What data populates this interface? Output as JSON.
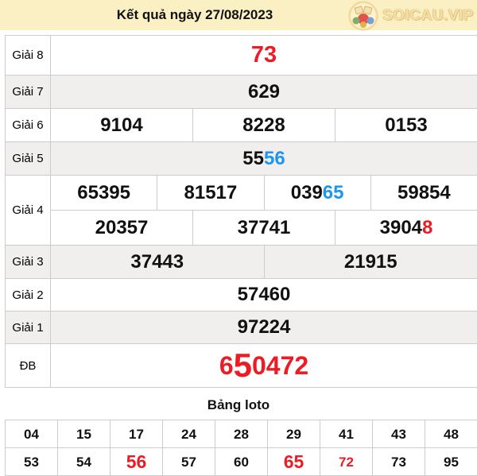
{
  "header": {
    "title": "Kết quả ngày 27/08/2023",
    "logo_text": "SOICAU.VIP"
  },
  "colors": {
    "accent_red": "#ed1c24",
    "accent_blue": "#1d96f0",
    "header_bg": "#fbf0c3",
    "row_alt_bg": "#f1efed"
  },
  "prize_table": {
    "rows": [
      {
        "label": "Giải 8",
        "bg": "white",
        "h": 49,
        "size": "xl",
        "lines": [
          [
            [
              {
                "t": "73",
                "c": "red"
              }
            ]
          ]
        ]
      },
      {
        "label": "Giải 7",
        "bg": "gray",
        "h": 42,
        "lines": [
          [
            [
              {
                "t": "629"
              }
            ]
          ]
        ]
      },
      {
        "label": "Giải 6",
        "bg": "white",
        "h": 42,
        "lines": [
          [
            [
              {
                "t": "9104"
              }
            ],
            [
              {
                "t": "8228"
              }
            ],
            [
              {
                "t": "0153"
              }
            ]
          ]
        ]
      },
      {
        "label": "Giải 5",
        "bg": "gray",
        "h": 42,
        "lines": [
          [
            [
              {
                "t": "55"
              },
              {
                "t": "56",
                "c": "blue"
              }
            ]
          ]
        ]
      },
      {
        "label": "Giải 4",
        "bg": "white",
        "h": 88,
        "lines": [
          [
            [
              {
                "t": "65395"
              }
            ],
            [
              {
                "t": "81517"
              }
            ],
            [
              {
                "t": "039"
              },
              {
                "t": "65",
                "c": "blue"
              }
            ],
            [
              {
                "t": "59854"
              }
            ]
          ],
          [
            [
              {
                "t": "20357"
              }
            ],
            [
              {
                "t": "37741"
              }
            ],
            [
              {
                "t": "3904"
              },
              {
                "t": "8",
                "c": "red"
              }
            ]
          ]
        ]
      },
      {
        "label": "Giải 3",
        "bg": "gray",
        "h": 42,
        "lines": [
          [
            [
              {
                "t": "37443"
              }
            ],
            [
              {
                "t": "21915"
              }
            ]
          ]
        ]
      },
      {
        "label": "Giải 2",
        "bg": "white",
        "h": 41,
        "lines": [
          [
            [
              {
                "t": "57460"
              }
            ]
          ]
        ]
      },
      {
        "label": "Giải 1",
        "bg": "gray",
        "h": 41,
        "lines": [
          [
            [
              {
                "t": "97224"
              }
            ]
          ]
        ]
      },
      {
        "label": "ĐB",
        "bg": "white",
        "h": 55,
        "size": "db",
        "lines": [
          [
            [
              {
                "t": "6",
                "c": "red"
              },
              {
                "t": "5",
                "c": "red",
                "big": true
              },
              {
                "t": "0472",
                "c": "red"
              }
            ]
          ]
        ]
      }
    ]
  },
  "loto": {
    "title": "Bảng loto",
    "rows": [
      [
        {
          "t": "04"
        },
        {
          "t": "15"
        },
        {
          "t": "17"
        },
        {
          "t": "24"
        },
        {
          "t": "28"
        },
        {
          "t": "29"
        },
        {
          "t": "41"
        },
        {
          "t": "43"
        },
        {
          "t": "48"
        }
      ],
      [
        {
          "t": "53"
        },
        {
          "t": "54"
        },
        {
          "t": "56",
          "s": "red-big"
        },
        {
          "t": "57"
        },
        {
          "t": "60"
        },
        {
          "t": "65",
          "s": "red-big"
        },
        {
          "t": "72",
          "s": "red"
        },
        {
          "t": "73"
        },
        {
          "t": "95"
        }
      ]
    ]
  }
}
